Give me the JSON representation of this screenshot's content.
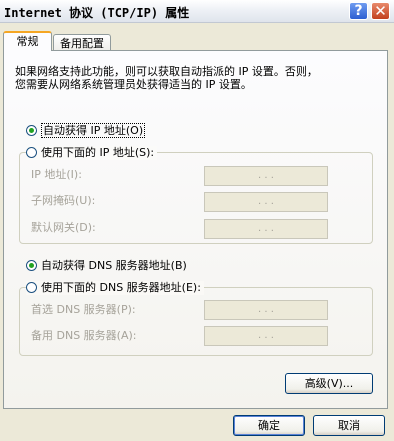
{
  "window": {
    "title": "Internet 协议 (TCP/IP) 属性",
    "help_label": "?",
    "close_label": "✕"
  },
  "tabs": [
    {
      "label": "常规",
      "selected": true
    },
    {
      "label": "备用配置",
      "selected": false
    }
  ],
  "description": {
    "line1": "如果网络支持此功能，则可以获取自动指派的 IP 设置。否则，",
    "line2": "您需要从网络系统管理员处获得适当的 IP 设置。"
  },
  "ip_section": {
    "auto_option": {
      "label": "自动获得 IP 地址(O)",
      "selected": true
    },
    "manual_option": {
      "label": "使用下面的 IP 地址(S):",
      "selected": false
    },
    "fields": [
      {
        "label": "IP 地址(I):",
        "value": ".   .   ."
      },
      {
        "label": "子网掩码(U):",
        "value": ".   .   ."
      },
      {
        "label": "默认网关(D):",
        "value": ".   .   ."
      }
    ]
  },
  "dns_section": {
    "auto_option": {
      "label": "自动获得 DNS 服务器地址(B)",
      "selected": true
    },
    "manual_option": {
      "label": "使用下面的 DNS 服务器地址(E):",
      "selected": false
    },
    "fields": [
      {
        "label": "首选 DNS 服务器(P):",
        "value": ".   .   ."
      },
      {
        "label": "备用 DNS 服务器(A):",
        "value": ".   .   ."
      }
    ]
  },
  "buttons": {
    "advanced": "高级(V)...",
    "ok": "确定",
    "cancel": "取消"
  }
}
